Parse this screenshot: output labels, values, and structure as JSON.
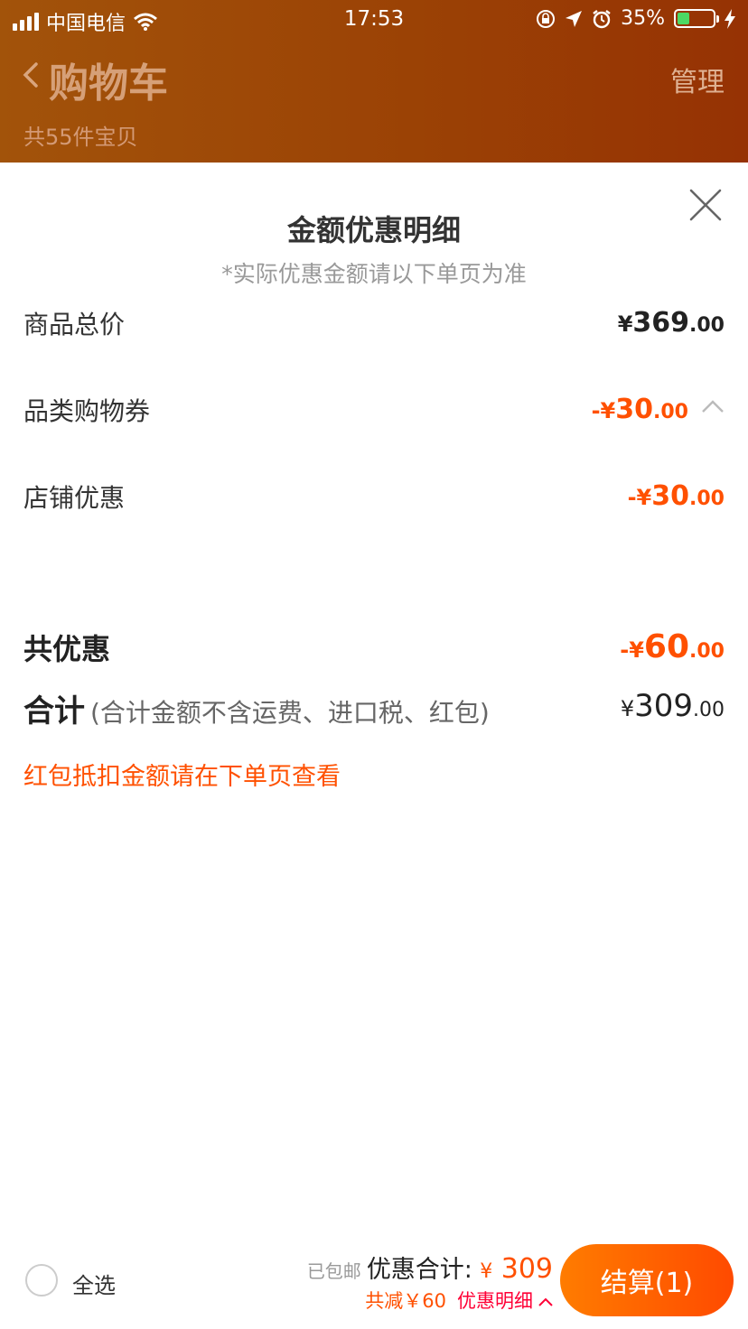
{
  "status_bar": {
    "carrier": "中国电信",
    "time": "17:53",
    "battery": "35%",
    "battery_level": 0.35
  },
  "header": {
    "title": "购物车",
    "manage_label": "管理",
    "item_count": "共55件宝贝"
  },
  "sheet": {
    "title": "金额优惠明细",
    "subtitle": "*实际优惠金额请以下单页为准",
    "rows": [
      {
        "label": "商品总价",
        "currency": "¥",
        "int": "369",
        "dec": ".00"
      },
      {
        "label": "品类购物券",
        "currency": "-¥",
        "int": "30",
        "dec": ".00"
      },
      {
        "label": "店铺优惠",
        "currency": "-¥",
        "int": "30",
        "dec": ".00"
      }
    ],
    "total_discount": {
      "label": "共优惠",
      "currency": "-¥",
      "int": "60",
      "dec": ".00"
    },
    "sum": {
      "label": "合计",
      "note": "(合计金额不含运费、进口税、红包)",
      "currency": "¥",
      "int": "309",
      "dec": ".00"
    },
    "red_packet_note": "红包抵扣金额请在下单页查看"
  },
  "bottom_bar": {
    "select_all": "全选",
    "free_shipping": "已包邮",
    "total_label": "优惠合计:",
    "total_currency": "¥",
    "total_value": "309",
    "reduced": "共减￥60",
    "detail_link": "优惠明细",
    "checkout": "结算(1)"
  },
  "colors": {
    "accent": "#ff5000",
    "link": "#ff0036",
    "header_bg": "#9b4205"
  }
}
